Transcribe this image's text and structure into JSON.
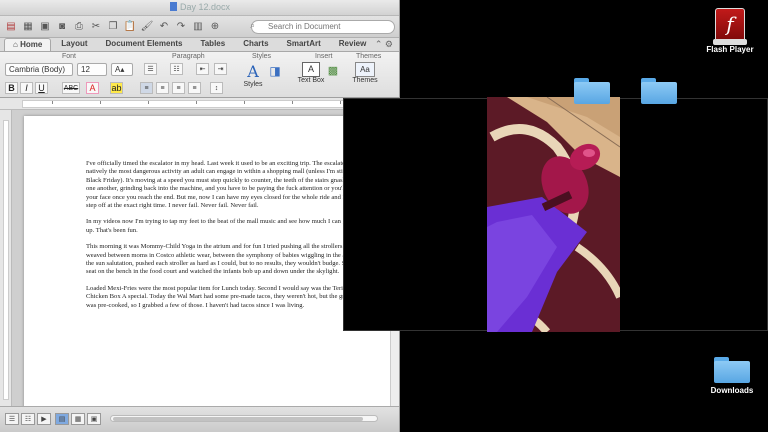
{
  "word": {
    "title": "Day 12.docx",
    "search_placeholder": "Search in Document",
    "ribbon_tabs": [
      "Home",
      "Layout",
      "Document Elements",
      "Tables",
      "Charts",
      "SmartArt",
      "Review"
    ],
    "groups": {
      "font": "Font",
      "paragraph": "Paragraph",
      "styles": "Styles",
      "insert": "Insert",
      "themes": "Themes"
    },
    "font_name": "Cambria (Body)",
    "font_size": "12",
    "styles_label": "Styles",
    "textbox_label": "Text Box",
    "themes_label": "Themes",
    "paragraphs": [
      "I've officially timed the escalator in my head. Last week it used to be an exciting trip. The escalator is natively the most dangerous activity an adult can engage in within a shopping mall (unless I'm still around by Black Friday). It's moving at a speed you must step quickly to counter, the teeth of the stairs gnashing into one another, grinding back into the machine, and you have to be paying the fuck attention or you'll fall flat on your face once you reach the end. But me, now I can have my eyes closed for the whole ride and I always step off at the exact right time. I never fail. Never fail. Never fail.",
      "In my videos now I'm trying to tap my feet to the beat of the mall music and see how much I can get it to line up. That's been fun.",
      "This morning it was Mommy-Child Yoga in the atrium and for fun I tried pushing all the strollers around. I weaved between moms in Costco athletic wear, between the symphony of babies wiggling in the air, during the sun salutation, pushed each stroller as hard as I could, but to no results, they wouldn't budge. So I took a seat on the bench in the food court and watched the infants bob up and down under the skylight.",
      "Loaded Mexi-Fries were the most popular item for Lunch today. Second I would say was the Teriyaki Chicken Box A special. Today the Wal Mart had some pre-made tacos, they weren't hot, but the ground beef was pre-cooked, so I grabbed a few of those. I haven't had tacos since I was living."
    ]
  },
  "desktop": {
    "flash_label": "Flash Player",
    "downloads_label": "Downloads"
  }
}
